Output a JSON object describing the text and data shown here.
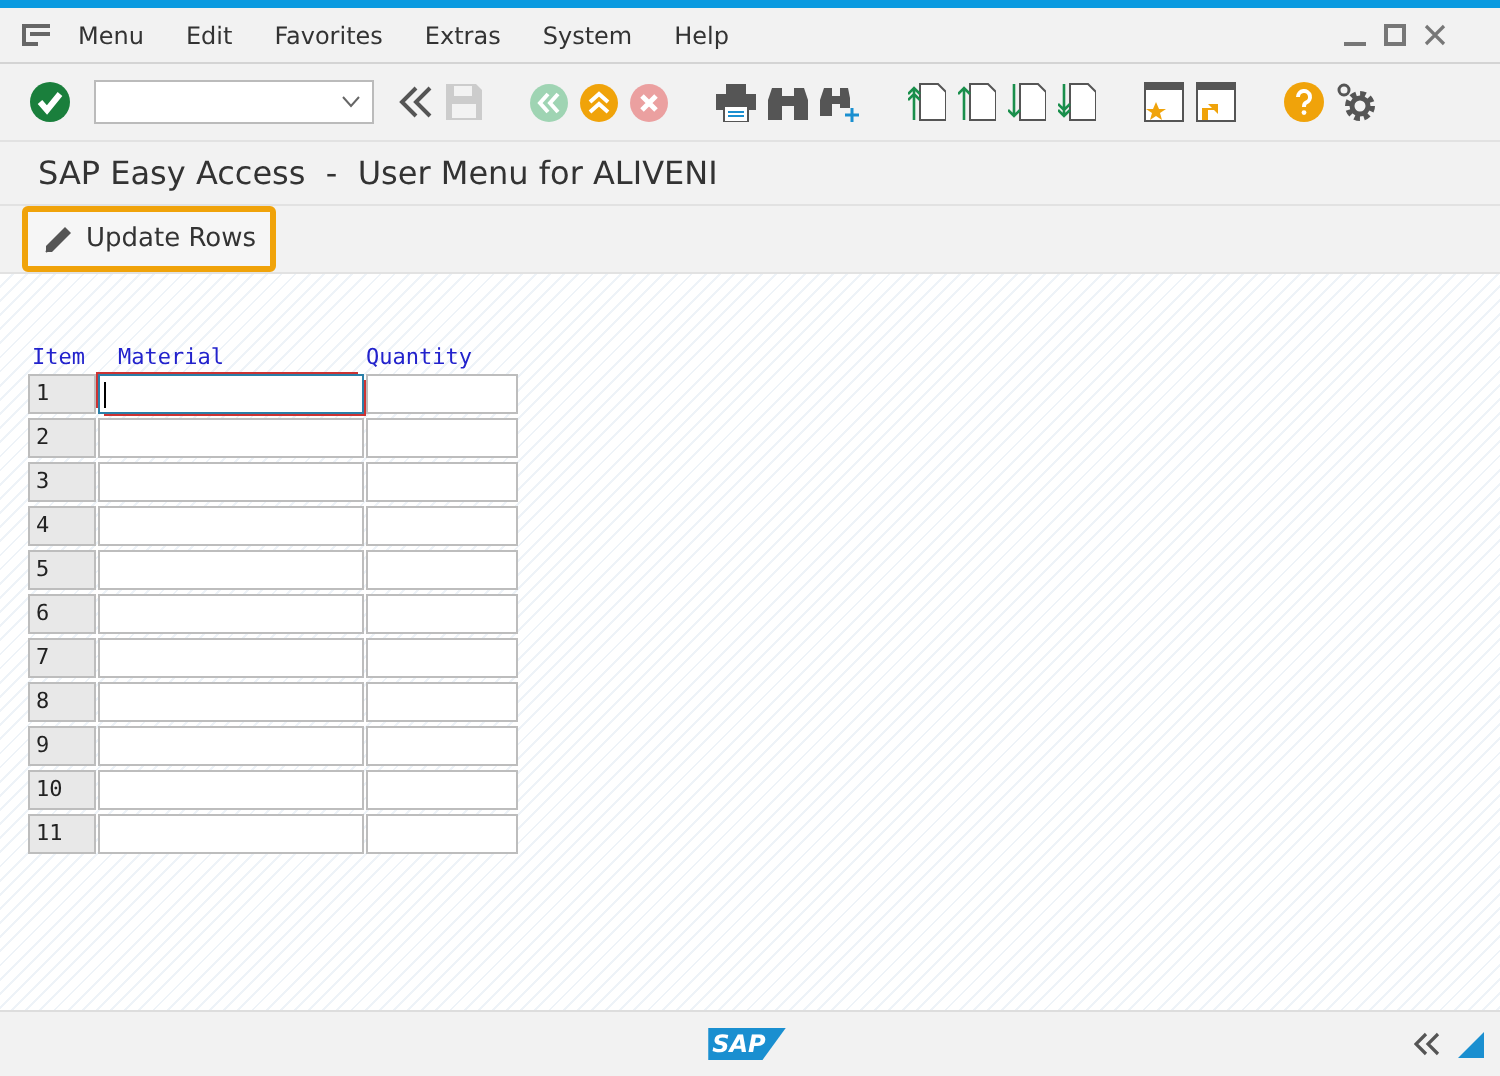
{
  "menu_bar": {
    "items": [
      "Menu",
      "Edit",
      "Favorites",
      "Extras",
      "System",
      "Help"
    ]
  },
  "title": "SAP Easy Access  -  User Menu for ALIVENI",
  "app_toolbar": {
    "buttons": [
      "Update Rows"
    ]
  },
  "table": {
    "columns": [
      "Item",
      "Material",
      "Quantity"
    ],
    "rows": [
      {
        "item": "1",
        "focused": true
      },
      {
        "item": "2",
        "focused": false
      },
      {
        "item": "3",
        "focused": false
      },
      {
        "item": "4",
        "focused": false
      },
      {
        "item": "5",
        "focused": false
      },
      {
        "item": "6",
        "focused": false
      },
      {
        "item": "7",
        "focused": false
      },
      {
        "item": "8",
        "focused": false
      },
      {
        "item": "9",
        "focused": false
      },
      {
        "item": "10",
        "focused": false
      },
      {
        "item": "11",
        "focused": false
      }
    ]
  },
  "footer": {
    "logo": "SAP"
  }
}
